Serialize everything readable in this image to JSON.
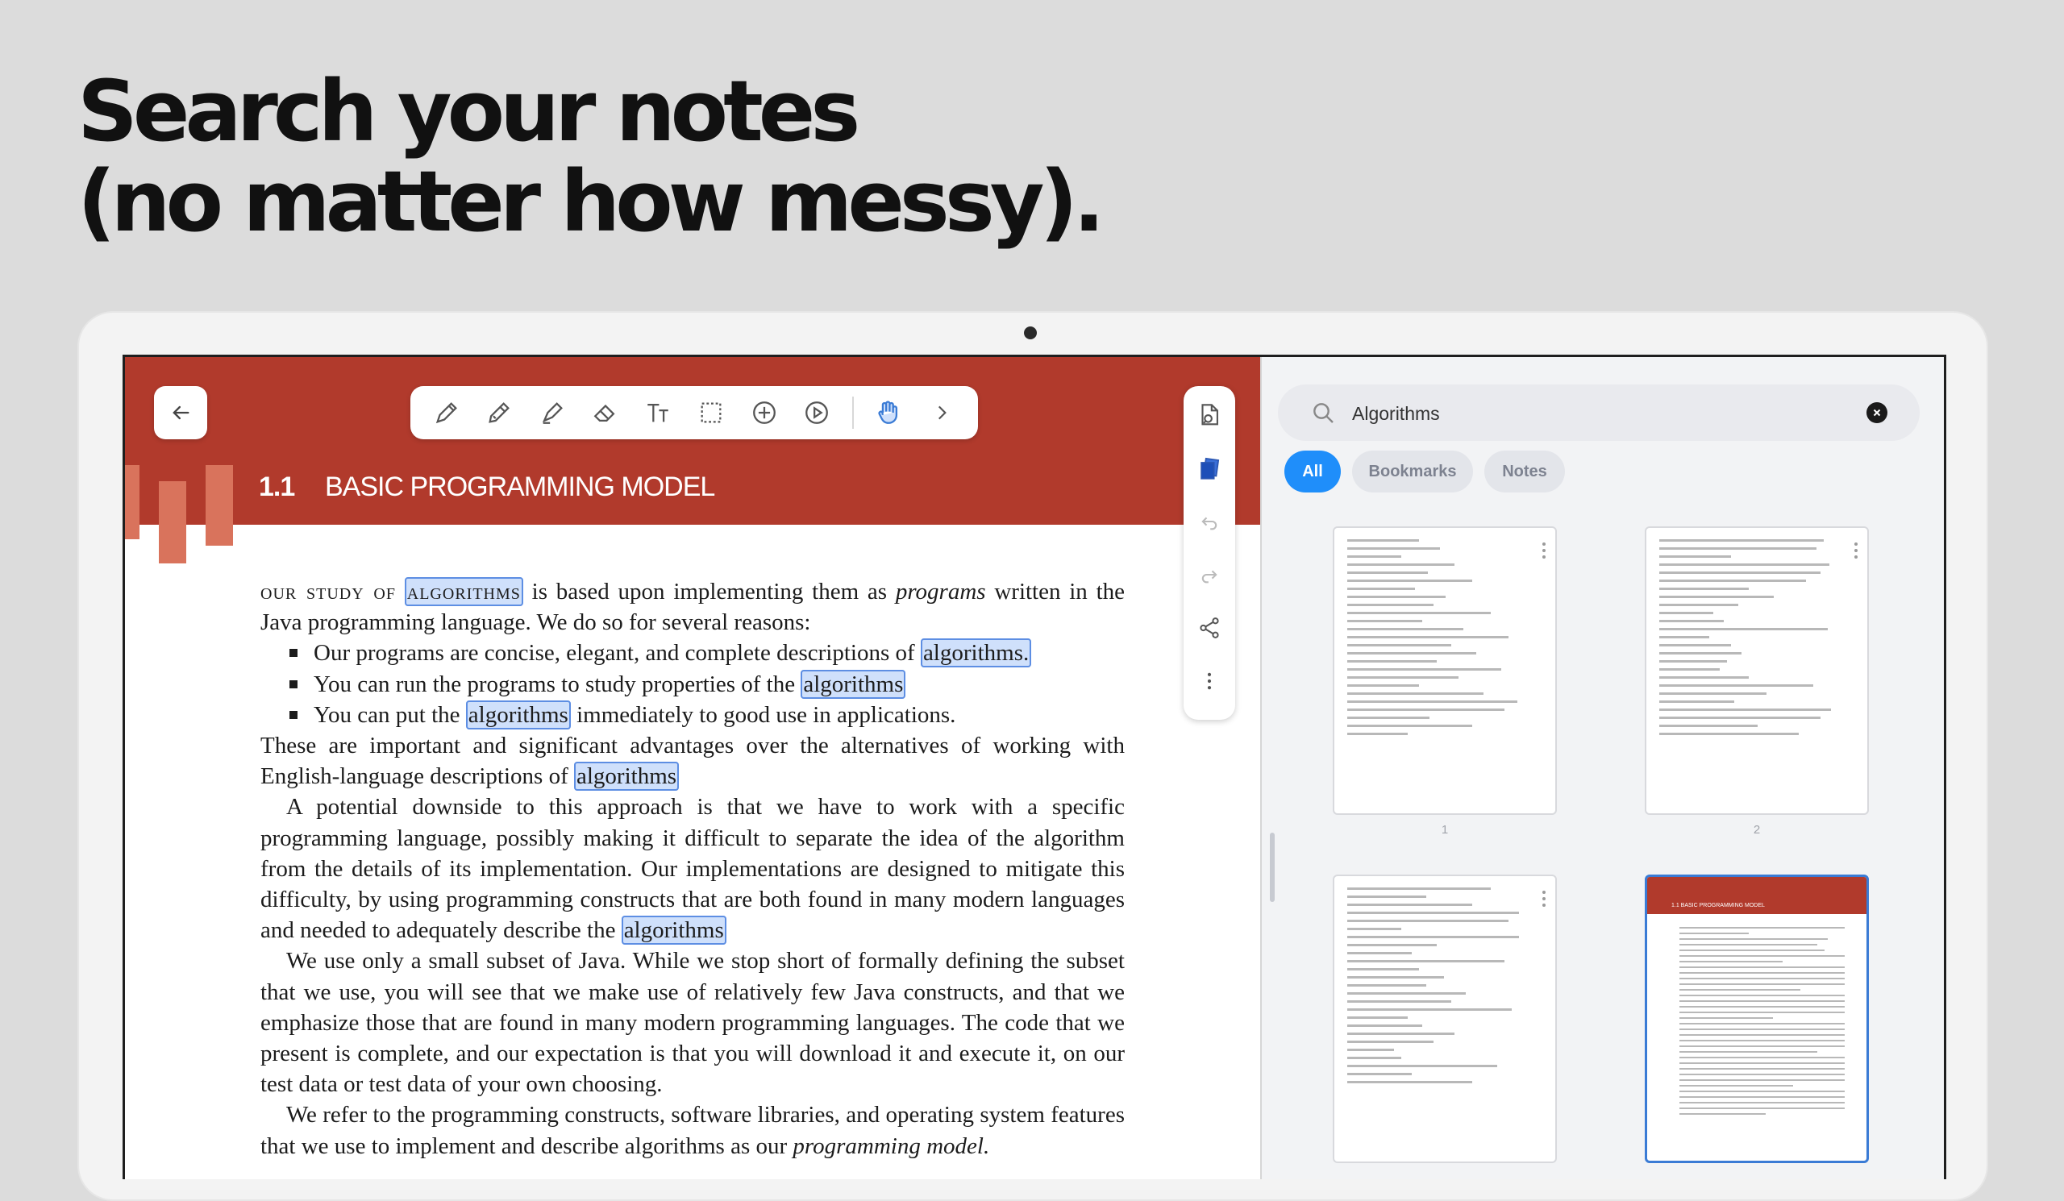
{
  "headline": {
    "line1": "Search your notes",
    "line2": "(no matter how messy)."
  },
  "document": {
    "section_number": "1.1",
    "section_title": "BASIC PROGRAMMING MODEL",
    "p1_lead": "our study of",
    "p1_hl": "algorithms",
    "p1_rest": "is based upon implementing them as",
    "p1_italic": "programs",
    "p1_end": "written in the Java programming language. We do so for several reasons:",
    "bullet1_text": "Our programs are concise, elegant, and complete descriptions of",
    "bullet1_hl": "algorithms.",
    "bullet2_text": "You can run the programs to study properties of the",
    "bullet2_hl": "algorithms",
    "bullet3_text": "You can put the",
    "bullet3_hl": "algorithms",
    "bullet3_end": "immediately to good use in applications.",
    "p2_text": "These are important and significant advantages over the alternatives of working with English-language descriptions of",
    "p2_hl": "algorithms",
    "p3_text": "A potential downside to this approach is that we have to work with a specific programming language, possibly making it difficult to separate the idea of the algorithm from the details of its implementation. Our implementations are designed to mitigate this difficulty, by using programming constructs that are both found in many modern languages and needed to adequately describe the",
    "p3_hl": "algorithms",
    "p4_text": "We use only a small subset of Java. While we stop short of formally defining the subset that we use, you will see that we make use of relatively few Java constructs, and that we emphasize those that are found in many modern programming languages. The code that we present is complete, and our expectation is that you will download it and execute it, on our test data or test data of your own choosing.",
    "p5_text": "We refer to the programming constructs, software libraries, and operating system features that we use to implement and describe algorithms as our",
    "p5_italic": "programming model."
  },
  "toolbar": {
    "tools": [
      "pen-icon",
      "pencil-icon",
      "highlighter-icon",
      "eraser-icon",
      "text-icon",
      "lasso-icon",
      "add-icon",
      "play-icon",
      "gesture-icon",
      "chevron-right-icon"
    ]
  },
  "side_tools": [
    "page-search-icon",
    "pages-icon",
    "undo-icon",
    "redo-icon",
    "share-icon",
    "more-icon"
  ],
  "search": {
    "value": "Algorithms",
    "filters": [
      "All",
      "Bookmarks",
      "Notes"
    ],
    "active_filter": "All"
  },
  "results": [
    {
      "label": "1"
    },
    {
      "label": "2"
    },
    {
      "label": ""
    },
    {
      "label": "",
      "title": "1.1 BASIC PROGRAMMING MODEL"
    }
  ],
  "colors": {
    "brand_red": "#b13a2c",
    "accent_blue": "#1f8efa",
    "highlight": "#cfe0fb"
  }
}
